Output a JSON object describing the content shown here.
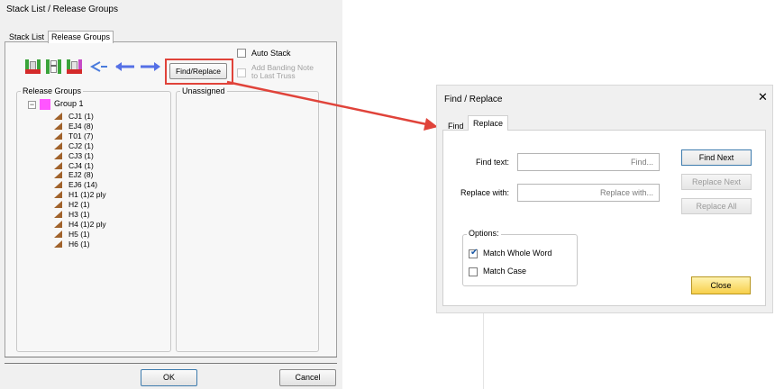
{
  "left_dialog": {
    "title": "Stack List / Release Groups",
    "tabs": [
      {
        "label": "Stack List"
      },
      {
        "label": "Release Groups"
      }
    ],
    "toolbar": {
      "find_replace_label": "Find/Replace",
      "icons": [
        "stack-red-icon",
        "stack-white-icon",
        "stack-split-icon",
        "cycle-arrows-icon",
        "arrow-left-icon",
        "arrow-right-icon"
      ]
    },
    "auto_stack": {
      "label": "Auto Stack",
      "checked": false
    },
    "banding_note": {
      "label_line1": "Add Banding Note",
      "label_line2": "to Last Truss",
      "checked": false,
      "enabled": false
    },
    "release_groups": {
      "title": "Release Groups",
      "group": {
        "label": "Group 1",
        "color": "#ff55ff"
      },
      "items": [
        {
          "label": "CJ1 (1)"
        },
        {
          "label": "EJ4 (8)"
        },
        {
          "label": "T01 (7)"
        },
        {
          "label": "CJ2 (1)"
        },
        {
          "label": "CJ3 (1)"
        },
        {
          "label": "CJ4 (1)"
        },
        {
          "label": "EJ2 (8)"
        },
        {
          "label": "EJ6 (14)"
        },
        {
          "label": "H1 (1)2 ply"
        },
        {
          "label": "H2 (1)"
        },
        {
          "label": "H3 (1)"
        },
        {
          "label": "H4 (1)2 ply"
        },
        {
          "label": "H5 (1)"
        },
        {
          "label": "H6 (1)"
        }
      ]
    },
    "unassigned": {
      "title": "Unassigned"
    },
    "ok_label": "OK",
    "cancel_label": "Cancel"
  },
  "right_dialog": {
    "title": "Find / Replace",
    "close_glyph": "✕",
    "tabs": [
      {
        "label": "Find"
      },
      {
        "label": "Replace"
      }
    ],
    "find_text": {
      "label": "Find text:",
      "placeholder": "Find...",
      "value": ""
    },
    "replace_with": {
      "label": "Replace with:",
      "placeholder": "Replace with...",
      "value": ""
    },
    "options": {
      "title": "Options:",
      "match_whole_word": {
        "label": "Match Whole Word",
        "checked": true
      },
      "match_case": {
        "label": "Match Case",
        "checked": false
      }
    },
    "find_next_label": "Find Next",
    "replace_next_label": "Replace Next",
    "replace_all_label": "Replace All",
    "close_label": "Close"
  },
  "colors": {
    "highlight": "#e0433a",
    "truss_icon": "#a0622b",
    "close_button": "#f7cf4a"
  }
}
